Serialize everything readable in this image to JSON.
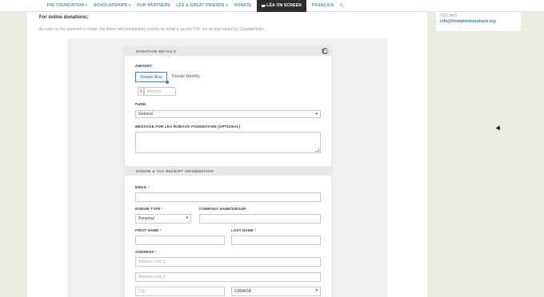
{
  "nav": {
    "items": [
      {
        "label": "THE FOUNDATION",
        "has_dropdown": true
      },
      {
        "label": "SCHOLARSHIPS",
        "has_dropdown": true
      },
      {
        "label": "OUR PARTNERS",
        "has_dropdown": false
      },
      {
        "label": "LÉA & GREAT FRIENDS",
        "has_dropdown": true
      },
      {
        "label": "DONATE",
        "has_dropdown": false
      },
      {
        "label": "LÉA ON SCREEN",
        "has_dropdown": false,
        "active": true
      },
      {
        "label": "FRANÇAIS",
        "has_dropdown": false
      }
    ],
    "search_icon": "search-icon",
    "dropdown_glyph": "∨"
  },
  "sidebar": {
    "postal": "H2X 3W5",
    "email": "info@fondationlearoback.org"
  },
  "page": {
    "title": "For online donations:",
    "note": "As soon as the payment is made, the donor will immediately receive by email a secure PDF tax receipt issued by CanadaHelps."
  },
  "form": {
    "donation_details": {
      "heading": "DONATION DETAILS",
      "amount_label": "AMOUNT",
      "donate_now": "Donate Now",
      "donate_monthly": "Donate Monthly",
      "currency_symbol": "$",
      "amount_placeholder": "Amount",
      "fund_label": "FUND",
      "fund_value": "General",
      "message_label": "MESSAGE FOR LEA ROBACK FOUNDATION (OPTIONAL)"
    },
    "donor_info": {
      "heading": "DONOR & TAX RECEIPT INFORMATION",
      "email_label": "EMAIL",
      "donor_type_label": "DONOR TYPE",
      "donor_type_value": "Personal",
      "company_label": "COMPANY NAME/GROUP",
      "first_name_label": "FIRST NAME",
      "last_name_label": "LAST NAME",
      "address_label": "ADDRESS",
      "address1_placeholder": "Address Line 1",
      "address2_placeholder": "Address Line 2",
      "city_placeholder": "City",
      "country_value": "CANADA",
      "required_mark": "*"
    }
  },
  "colors": {
    "accent": "#3d87b5",
    "nav_text": "#5a8fa8",
    "active_nav_bg": "#2d2d2d",
    "page_bg": "#ecebdf"
  }
}
